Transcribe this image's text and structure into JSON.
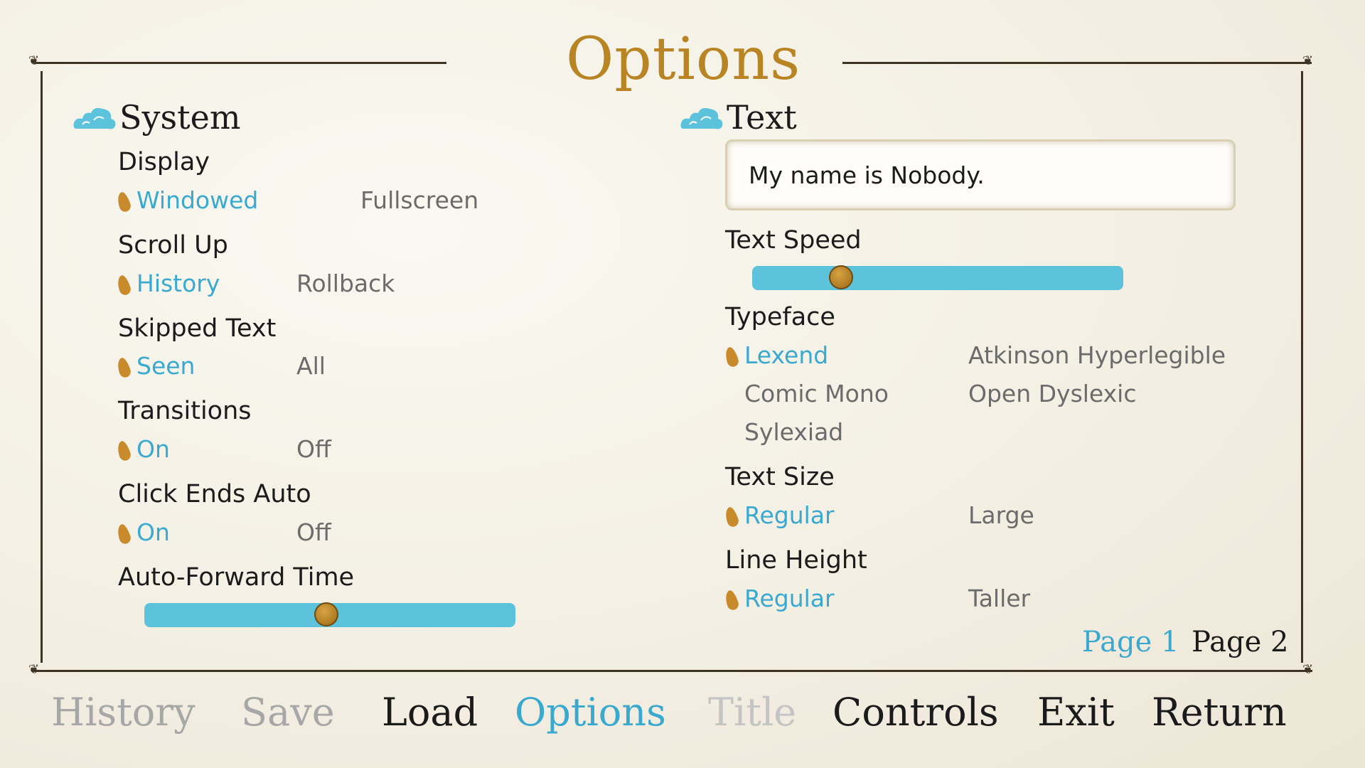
{
  "title": "Options",
  "colors": {
    "accent": "#b98524",
    "selected": "#3aa9cf",
    "slider": "#5dc3dd",
    "muted": "#6b6b6b",
    "disabled": "#a7a7a7"
  },
  "system": {
    "heading": "System",
    "display": {
      "label": "Display",
      "options": [
        "Windowed",
        "Fullscreen"
      ]
    },
    "scroll_up": {
      "label": "Scroll Up",
      "options": [
        "History",
        "Rollback"
      ]
    },
    "skipped_text": {
      "label": "Skipped Text",
      "options": [
        "Seen",
        "All"
      ]
    },
    "transitions": {
      "label": "Transitions",
      "options": [
        "On",
        "Off"
      ]
    },
    "click_ends_auto": {
      "label": "Click Ends Auto",
      "options": [
        "On",
        "Off"
      ]
    },
    "auto_forward": {
      "label": "Auto-Forward Time",
      "value": 0.49
    }
  },
  "text": {
    "heading": "Text",
    "preview": "My name is Nobody.",
    "text_speed": {
      "label": "Text Speed",
      "value": 0.24
    },
    "typeface": {
      "label": "Typeface",
      "options": [
        "Lexend",
        "Atkinson Hyperlegible",
        "Comic Mono",
        "Open Dyslexic",
        "Sylexiad"
      ]
    },
    "text_size": {
      "label": "Text Size",
      "options": [
        "Regular",
        "Large"
      ]
    },
    "line_height": {
      "label": "Line Height",
      "options": [
        "Regular",
        "Taller"
      ]
    }
  },
  "pages": [
    "Page 1",
    "Page 2"
  ],
  "nav": [
    "History",
    "Save",
    "Load",
    "Options",
    "Title",
    "Controls",
    "Exit",
    "Return"
  ],
  "icons": {
    "section": "cloud-icon",
    "selection": "leaf-icon"
  }
}
